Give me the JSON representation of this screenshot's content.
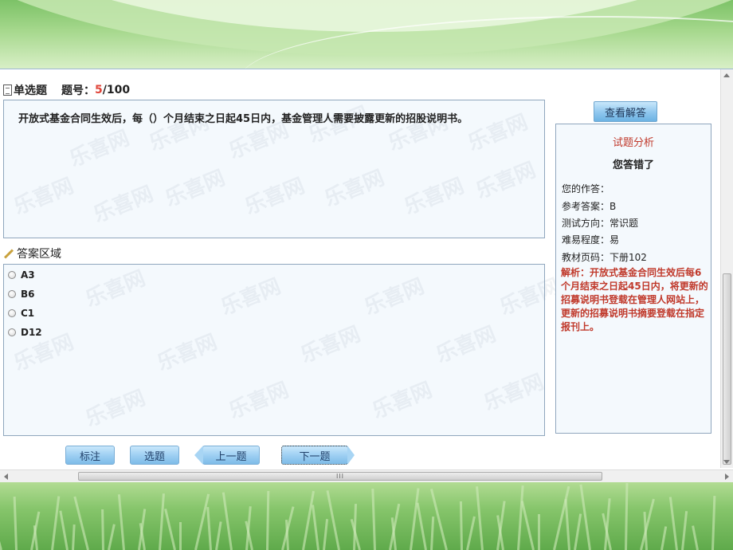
{
  "header": {
    "question_type": "单选题",
    "question_number_label": "题号：",
    "current_number": "5",
    "total_separator": "/100"
  },
  "question": {
    "text": "开放式基金合同生效后，每（）个月结束之日起45日内，基金管理人需要披露更新的招股说明书。"
  },
  "answer_area": {
    "label": "答案区域",
    "options": [
      "A3",
      "B6",
      "C1",
      "D12"
    ]
  },
  "buttons": {
    "mark": "标注",
    "select": "选题",
    "prev": "上一题",
    "next": "下一题",
    "view_answer": "查看解答"
  },
  "analysis": {
    "title": "试题分析",
    "verdict": "您答错了",
    "your_answer": "您的作答：",
    "reference_answer": "参考答案：B",
    "test_direction": "测试方向：常识题",
    "difficulty": "难易程度：易",
    "textbook_page": "教材页码：下册102",
    "explanation": "解析：开放式基金合同生效后每6个月结束之日起45日内，将更新的招募说明书登载在管理人网站上，更新的招募说明书摘要登载在指定报刊上。"
  },
  "watermark": "乐喜网",
  "scrollbar": {
    "grip": "III"
  },
  "colors": {
    "accent_red": "#e0453a",
    "analysis_red": "#c0392b",
    "button_blue": "#9fd0f3",
    "panel_bg": "#f4f9fd",
    "bg_green": "#86c56b"
  }
}
